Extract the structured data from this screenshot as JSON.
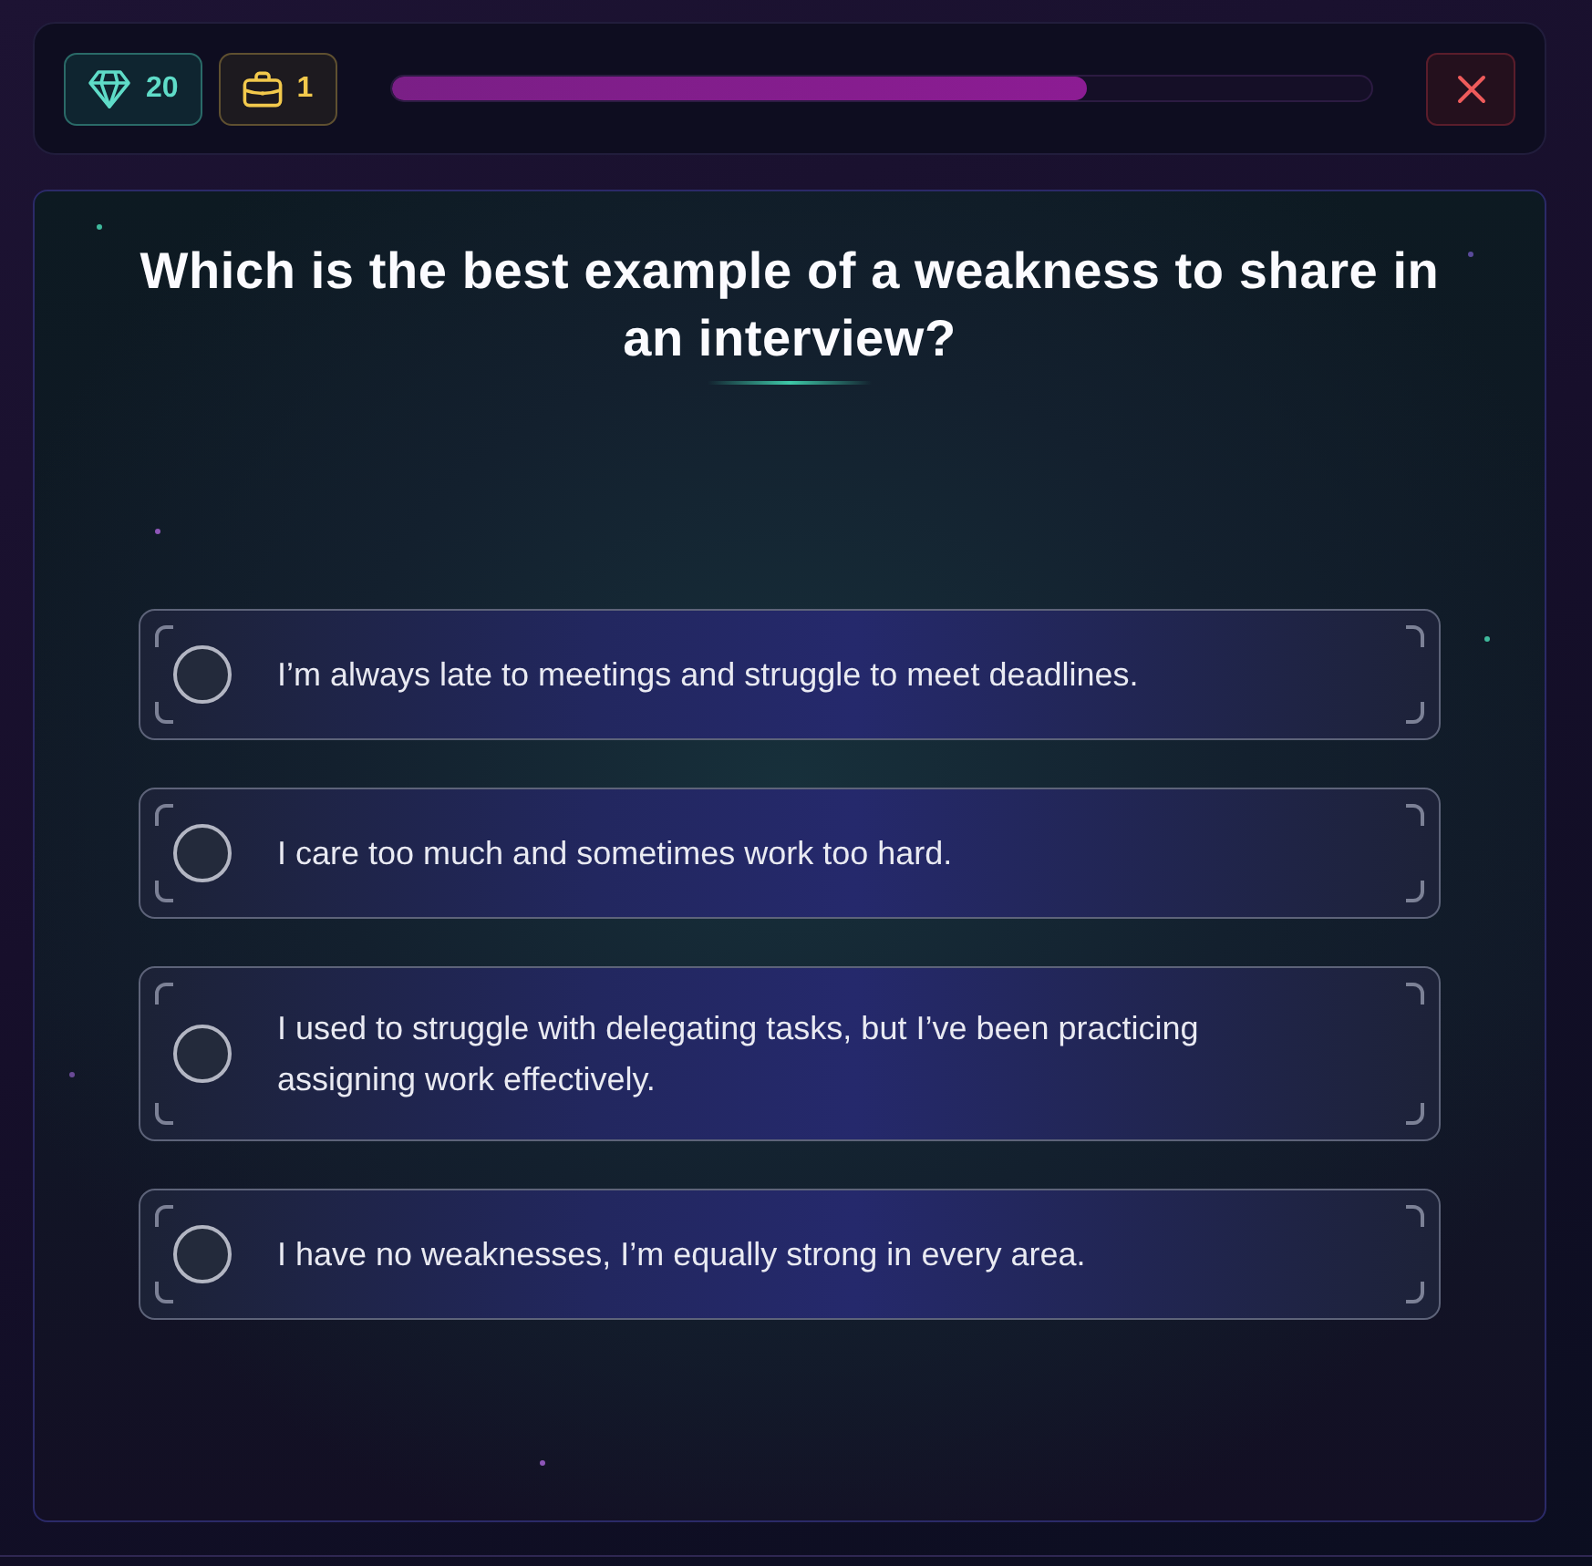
{
  "stats": [
    {
      "kind": "gems",
      "value": "20"
    },
    {
      "kind": "briefcases",
      "value": "1"
    }
  ],
  "progress": {
    "level": 0.71
  },
  "question": {
    "title": "Which is the best example of a weakness to share in an interview?"
  },
  "options": [
    {
      "text": "I’m always late to meetings and struggle to meet deadlines.",
      "selected": false
    },
    {
      "text": "I care too much and sometimes work too hard.",
      "selected": false
    },
    {
      "text": "I used to struggle with delegating tasks, but I’ve been practicing assigning work effectively.",
      "selected": false
    },
    {
      "text": "I have no weaknesses, I’m equally strong in every area.",
      "selected": false
    }
  ]
}
